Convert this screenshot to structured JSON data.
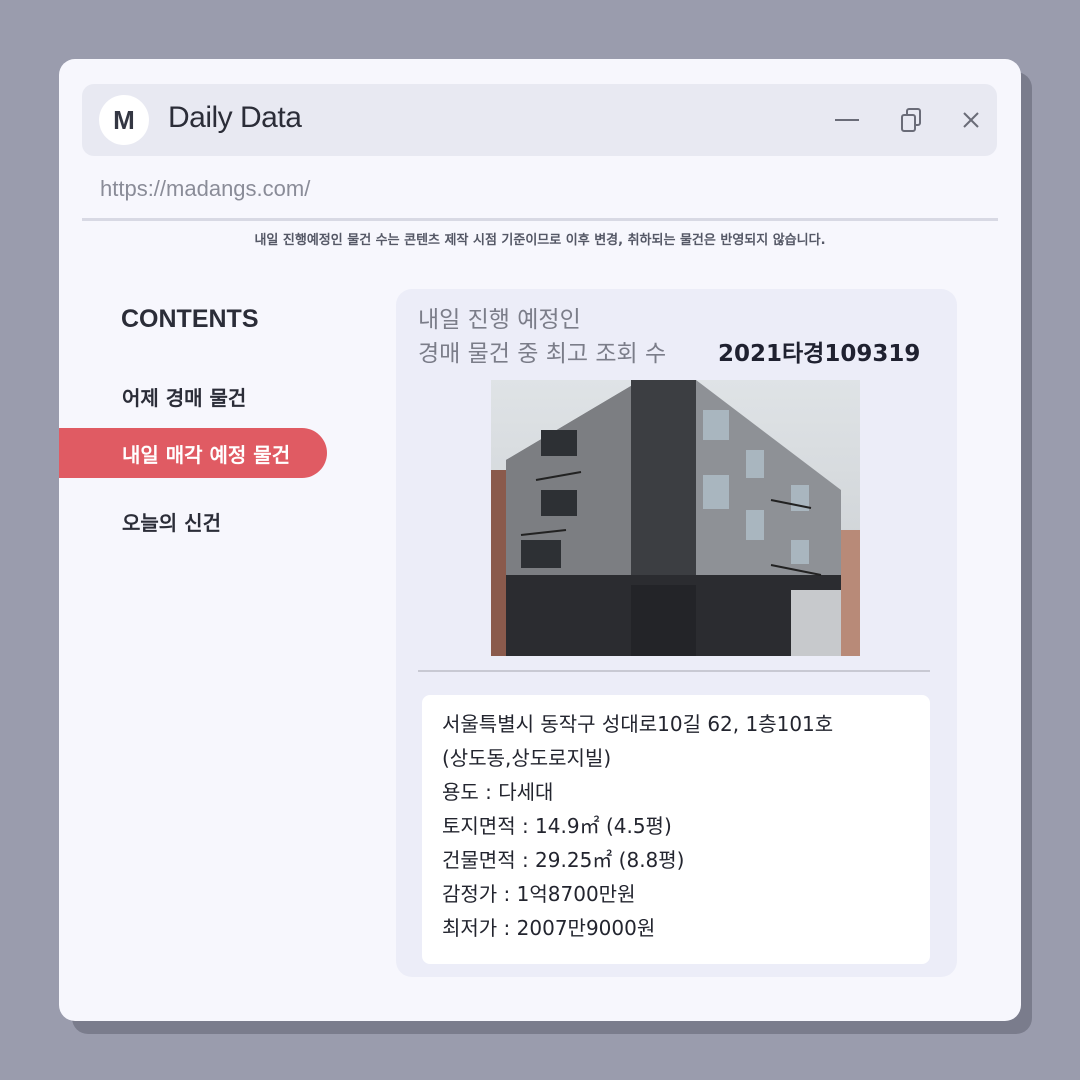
{
  "app": {
    "logo_letter": "M",
    "title": "Daily Data",
    "url": "https://madangs.com/"
  },
  "window_controls": {
    "minimize_icon": "minimize-icon",
    "copy_icon": "copy-icon",
    "close_icon": "close-icon"
  },
  "notice": "내일 진행예정인 물건 수는 콘텐츠 제작 시점 기준이므로 이후 변경, 취하되는 물건은 반영되지 않습니다.",
  "sidebar": {
    "title": "CONTENTS",
    "items": [
      {
        "label": "어제 경매 물건",
        "active": false
      },
      {
        "label": "내일 매각 예정 물건",
        "active": true
      },
      {
        "label": "오늘의 신건",
        "active": false
      }
    ]
  },
  "card": {
    "heading_line1": "내일 진행 예정인",
    "heading_line2": "경매 물건 중 최고 조회 수",
    "case_number": "2021타경109319",
    "details": {
      "address_line1": "서울특별시 동작구 성대로10길 62, 1층101호",
      "address_line2": "(상도동,상도로지빌)",
      "usage": "용도 : 다세대",
      "land_area": "토지면적 : 14.9㎡ (4.5평)",
      "building_area": "건물면적 : 29.25㎡ (8.8평)",
      "appraisal": "감정가 : 1억8700만원",
      "minimum_price": "최저가 : 2007만9000원"
    }
  },
  "colors": {
    "background": "#9a9cad",
    "window": "#f7f7fd",
    "accent": "#e05b63",
    "card": "#ecedf8"
  }
}
